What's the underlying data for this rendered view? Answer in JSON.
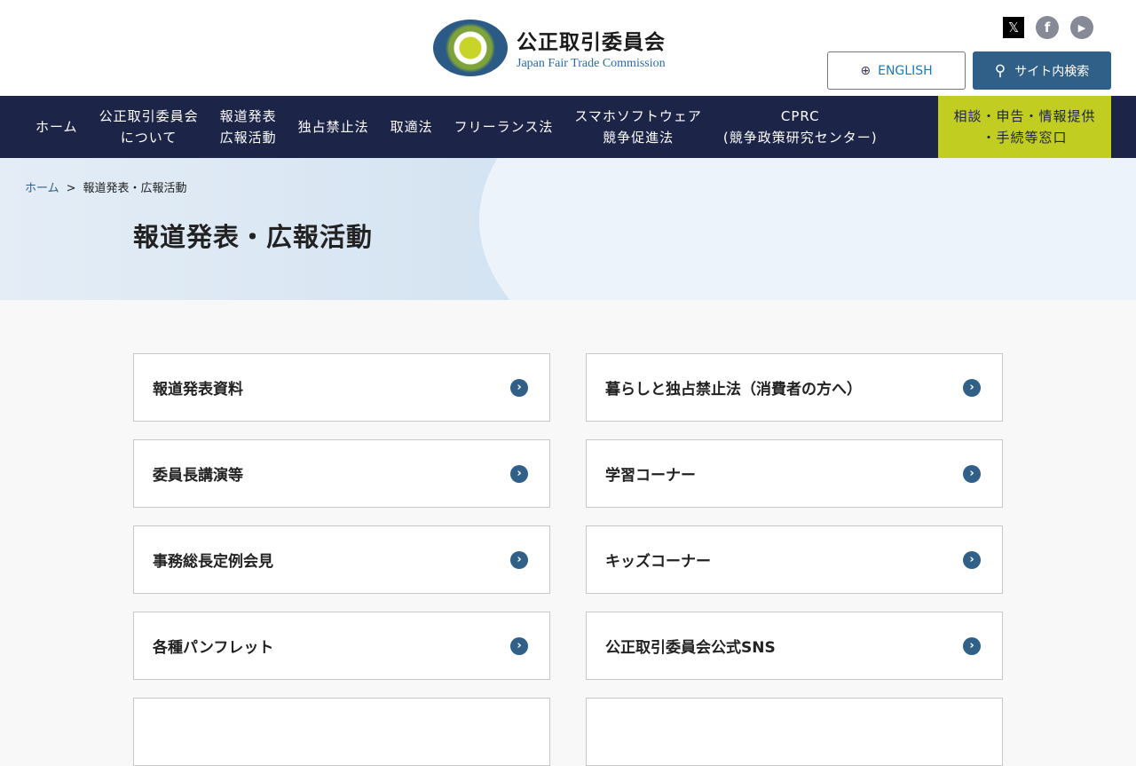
{
  "header": {
    "logo_jp": "公正取引委員会",
    "logo_en": "Japan Fair Trade Commission",
    "english_label": "ENGLISH",
    "search_label": "サイト内検索",
    "social": [
      {
        "icon": "x-icon",
        "glyph": "𝕏"
      },
      {
        "icon": "facebook-icon",
        "glyph": "f"
      },
      {
        "icon": "youtube-icon",
        "glyph": "▶"
      }
    ]
  },
  "nav": [
    "ホーム",
    "公正取引委員会\nについて",
    "報道発表\n広報活動",
    "独占禁止法",
    "取適法",
    "フリーランス法",
    "スマホソフトウェア\n競争促進法",
    "CPRC\n(競争政策研究センター)",
    "相談・申告・情報提供\n・手続等窓口"
  ],
  "breadcrumb": {
    "home": "ホーム",
    "sep": ">",
    "current": "報道発表・広報活動"
  },
  "page_title": "報道発表・広報活動",
  "cards": [
    "報道発表資料",
    "暮らしと独占禁止法（消費者の方へ）",
    "委員長講演等",
    "学習コーナー",
    "事務総長定例会見",
    "キッズコーナー",
    "各種パンフレット",
    "公正取引委員会公式SNS",
    "",
    ""
  ]
}
